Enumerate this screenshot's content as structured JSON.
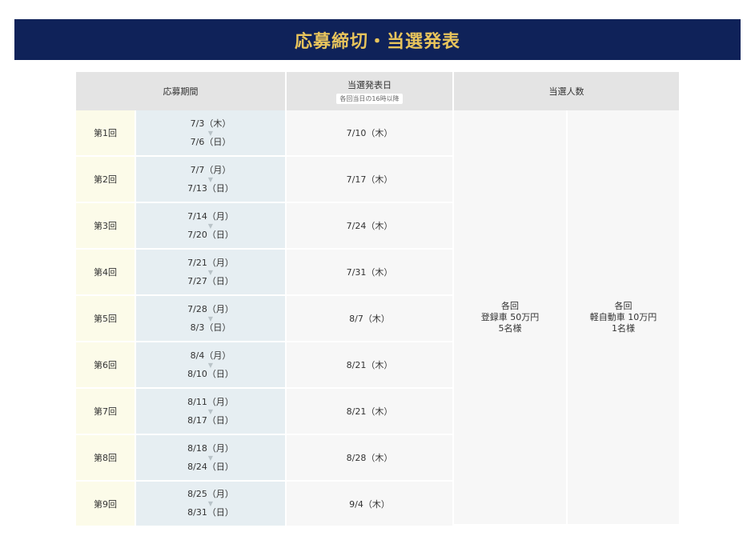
{
  "banner": {
    "title": "応募締切・当選発表"
  },
  "table": {
    "headers": {
      "period": "応募期間",
      "announce": "当選発表日",
      "announce_note": "各回当日の16時以降",
      "winners": "当選人数"
    },
    "rows": [
      {
        "round": "第1回",
        "start": "7/3（木）",
        "end": "7/6（日）",
        "announce": "7/10（木）"
      },
      {
        "round": "第2回",
        "start": "7/7（月）",
        "end": "7/13（日）",
        "announce": "7/17（木）"
      },
      {
        "round": "第3回",
        "start": "7/14（月）",
        "end": "7/20（日）",
        "announce": "7/24（木）"
      },
      {
        "round": "第4回",
        "start": "7/21（月）",
        "end": "7/27（日）",
        "announce": "7/31（木）"
      },
      {
        "round": "第5回",
        "start": "7/28（月）",
        "end": "8/3（日）",
        "announce": "8/7（木）"
      },
      {
        "round": "第6回",
        "start": "8/4（月）",
        "end": "8/10（日）",
        "announce": "8/21（木）"
      },
      {
        "round": "第7回",
        "start": "8/11（月）",
        "end": "8/17（日）",
        "announce": "8/21（木）"
      },
      {
        "round": "第8回",
        "start": "8/18（月）",
        "end": "8/24（日）",
        "announce": "8/28（木）"
      },
      {
        "round": "第9回",
        "start": "8/25（月）",
        "end": "8/31（日）",
        "announce": "9/4（木）"
      }
    ],
    "prizes": [
      {
        "line1": "各回",
        "line2": "登録車 50万円",
        "line3": "5名様"
      },
      {
        "line1": "各回",
        "line2": "軽自動車 10万円",
        "line3": "1名様"
      }
    ]
  },
  "icons": {
    "period_arrow": "down-triangle-icon"
  },
  "colors": {
    "banner_bg": "#0f2259",
    "banner_text": "#e8c45c",
    "header_bg": "#e4e4e4",
    "round_bg": "#fcfbe9",
    "period_bg": "#e6eef2",
    "cell_bg": "#f7f7f7"
  }
}
